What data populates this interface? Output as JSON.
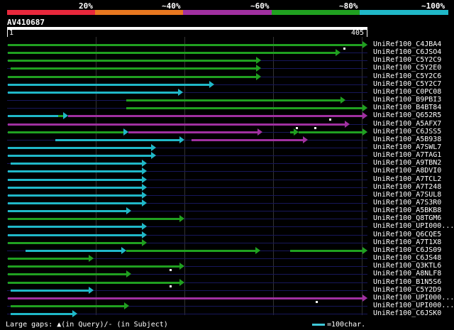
{
  "percent_labels": [
    "20%",
    "~40%",
    "~60%",
    "~80%",
    "~100%"
  ],
  "identity_colors": [
    "#e8283c",
    "#e87820",
    "#a030a0",
    "#20a020",
    "#20b8c8"
  ],
  "query": {
    "name": "AV410687",
    "start": "1",
    "end": "405"
  },
  "legend": {
    "gaps_text": "Large gaps: ▲(in Query)/- (in Subject)",
    "scale_text": "=100char."
  },
  "hits": [
    {
      "name": "UniRef100_C4JBA4",
      "segments": [
        {
          "s": 2,
          "e": 405,
          "c": "#20a020",
          "arrow": true
        }
      ],
      "gaps": [
        378
      ]
    },
    {
      "name": "UniRef100_C6JSO4",
      "segments": [
        {
          "s": 2,
          "e": 375,
          "c": "#20a020",
          "arrow": true
        }
      ],
      "gaps": []
    },
    {
      "name": "UniRef100_C5Y2C9",
      "segments": [
        {
          "s": 2,
          "e": 286,
          "c": "#20a020",
          "arrow": true
        }
      ],
      "gaps": []
    },
    {
      "name": "UniRef100_C5Y2E0",
      "segments": [
        {
          "s": 5,
          "e": 286,
          "c": "#20a020",
          "arrow": true
        }
      ],
      "gaps": []
    },
    {
      "name": "UniRef100_C5Y2C6",
      "segments": [
        {
          "s": 2,
          "e": 286,
          "c": "#20a020",
          "arrow": true
        }
      ],
      "gaps": []
    },
    {
      "name": "UniRef100_C5Y2C7",
      "segments": [
        {
          "s": 2,
          "e": 233,
          "c": "#20b8c8",
          "arrow": true
        }
      ],
      "gaps": []
    },
    {
      "name": "UniRef100_C0PC08",
      "segments": [
        {
          "s": 2,
          "e": 198,
          "c": "#20b8c8",
          "arrow": true
        }
      ],
      "gaps": []
    },
    {
      "name": "UniRef100_B9PBI3",
      "segments": [
        {
          "s": 135,
          "e": 380,
          "c": "#20a020",
          "arrow": true
        }
      ],
      "gaps": []
    },
    {
      "name": "UniRef100_B4BT84",
      "segments": [
        {
          "s": 135,
          "e": 405,
          "c": "#20a020",
          "arrow": true
        }
      ],
      "gaps": []
    },
    {
      "name": "UniRef100_Q652R5",
      "segments": [
        {
          "s": 2,
          "e": 58,
          "c": "#20b8c8",
          "arrow": false
        },
        {
          "s": 58,
          "e": 64,
          "c": "#20a020",
          "arrow": false
        },
        {
          "s": 64,
          "e": 69,
          "c": "#20b8c8",
          "arrow": true
        },
        {
          "s": 69,
          "e": 405,
          "c": "#a030a0",
          "arrow": true
        }
      ],
      "gaps": [
        362
      ]
    },
    {
      "name": "UniRef100_A5AFX7",
      "segments": [
        {
          "s": 2,
          "e": 385,
          "c": "#a030a0",
          "arrow": true
        }
      ],
      "gaps": [
        325,
        345
      ]
    },
    {
      "name": "UniRef100_C6JSS5",
      "segments": [
        {
          "s": 2,
          "e": 132,
          "c": "#20a020",
          "arrow": false
        },
        {
          "s": 132,
          "e": 137,
          "c": "#20b8c8",
          "arrow": true
        },
        {
          "s": 137,
          "e": 287,
          "c": "#a030a0",
          "arrow": true
        },
        {
          "s": 318,
          "e": 328,
          "c": "#20a020",
          "arrow": true
        },
        {
          "s": 328,
          "e": 405,
          "c": "#20a020",
          "arrow": true
        }
      ],
      "gaps": []
    },
    {
      "name": "UniRef100_A5B938",
      "segments": [
        {
          "s": 55,
          "e": 200,
          "c": "#20b8c8",
          "arrow": true
        },
        {
          "s": 208,
          "e": 338,
          "c": "#a030a0",
          "arrow": true
        }
      ],
      "gaps": []
    },
    {
      "name": "UniRef100_A7SWL7",
      "segments": [
        {
          "s": 2,
          "e": 168,
          "c": "#20b8c8",
          "arrow": true
        }
      ],
      "gaps": []
    },
    {
      "name": "UniRef100_A7TAG1",
      "segments": [
        {
          "s": 2,
          "e": 168,
          "c": "#20b8c8",
          "arrow": true
        }
      ],
      "gaps": []
    },
    {
      "name": "UniRef100_A9TBN2",
      "segments": [
        {
          "s": 5,
          "e": 158,
          "c": "#20b8c8",
          "arrow": true
        }
      ],
      "gaps": []
    },
    {
      "name": "UniRef100_A8DVI0",
      "segments": [
        {
          "s": 2,
          "e": 158,
          "c": "#20b8c8",
          "arrow": true
        }
      ],
      "gaps": []
    },
    {
      "name": "UniRef100_A7TCL2",
      "segments": [
        {
          "s": 2,
          "e": 158,
          "c": "#20b8c8",
          "arrow": true
        }
      ],
      "gaps": []
    },
    {
      "name": "UniRef100_A7T248",
      "segments": [
        {
          "s": 2,
          "e": 158,
          "c": "#20b8c8",
          "arrow": true
        }
      ],
      "gaps": []
    },
    {
      "name": "UniRef100_A7SUL8",
      "segments": [
        {
          "s": 2,
          "e": 158,
          "c": "#20b8c8",
          "arrow": true
        }
      ],
      "gaps": []
    },
    {
      "name": "UniRef100_A7S3R0",
      "segments": [
        {
          "s": 2,
          "e": 158,
          "c": "#20b8c8",
          "arrow": true
        }
      ],
      "gaps": []
    },
    {
      "name": "UniRef100_A5BKB8",
      "segments": [
        {
          "s": 2,
          "e": 140,
          "c": "#20b8c8",
          "arrow": true
        }
      ],
      "gaps": []
    },
    {
      "name": "UniRef100_Q8TGM6",
      "segments": [
        {
          "s": 2,
          "e": 200,
          "c": "#20a020",
          "arrow": true
        }
      ],
      "gaps": []
    },
    {
      "name": "UniRef100_UPI000...",
      "segments": [
        {
          "s": 2,
          "e": 158,
          "c": "#20b8c8",
          "arrow": true
        }
      ],
      "gaps": []
    },
    {
      "name": "UniRef100_Q6CQE5",
      "segments": [
        {
          "s": 2,
          "e": 158,
          "c": "#20b8c8",
          "arrow": true
        }
      ],
      "gaps": []
    },
    {
      "name": "UniRef100_A7T1X8",
      "segments": [
        {
          "s": 2,
          "e": 158,
          "c": "#20a020",
          "arrow": true
        }
      ],
      "gaps": []
    },
    {
      "name": "UniRef100_C6JS09",
      "segments": [
        {
          "s": 22,
          "e": 135,
          "c": "#20b8c8",
          "arrow": true
        },
        {
          "s": 135,
          "e": 285,
          "c": "#20a020",
          "arrow": true
        },
        {
          "s": 318,
          "e": 405,
          "c": "#20a020",
          "arrow": true
        }
      ],
      "gaps": []
    },
    {
      "name": "UniRef100_C6JS48",
      "segments": [
        {
          "s": 2,
          "e": 98,
          "c": "#20a020",
          "arrow": true
        }
      ],
      "gaps": []
    },
    {
      "name": "UniRef100_Q3KTL6",
      "segments": [
        {
          "s": 2,
          "e": 200,
          "c": "#20a020",
          "arrow": true
        }
      ],
      "gaps": [
        183
      ]
    },
    {
      "name": "UniRef100_A8NLF8",
      "segments": [
        {
          "s": 2,
          "e": 140,
          "c": "#20a020",
          "arrow": true
        }
      ],
      "gaps": []
    },
    {
      "name": "UniRef100_B1N5S6",
      "segments": [
        {
          "s": 2,
          "e": 200,
          "c": "#20a020",
          "arrow": true
        }
      ],
      "gaps": [
        183
      ]
    },
    {
      "name": "UniRef100_C5Y2D9",
      "segments": [
        {
          "s": 5,
          "e": 98,
          "c": "#20b8c8",
          "arrow": true
        }
      ],
      "gaps": []
    },
    {
      "name": "UniRef100_UPI000...",
      "segments": [
        {
          "s": 2,
          "e": 405,
          "c": "#a030a0",
          "arrow": true
        }
      ],
      "gaps": [
        347
      ]
    },
    {
      "name": "UniRef100_UPI000...",
      "segments": [
        {
          "s": 5,
          "e": 138,
          "c": "#20a020",
          "arrow": true
        }
      ],
      "gaps": []
    },
    {
      "name": "UniRef100_C6JSK0",
      "segments": [
        {
          "s": 5,
          "e": 80,
          "c": "#20b8c8",
          "arrow": true
        }
      ],
      "gaps": []
    }
  ]
}
